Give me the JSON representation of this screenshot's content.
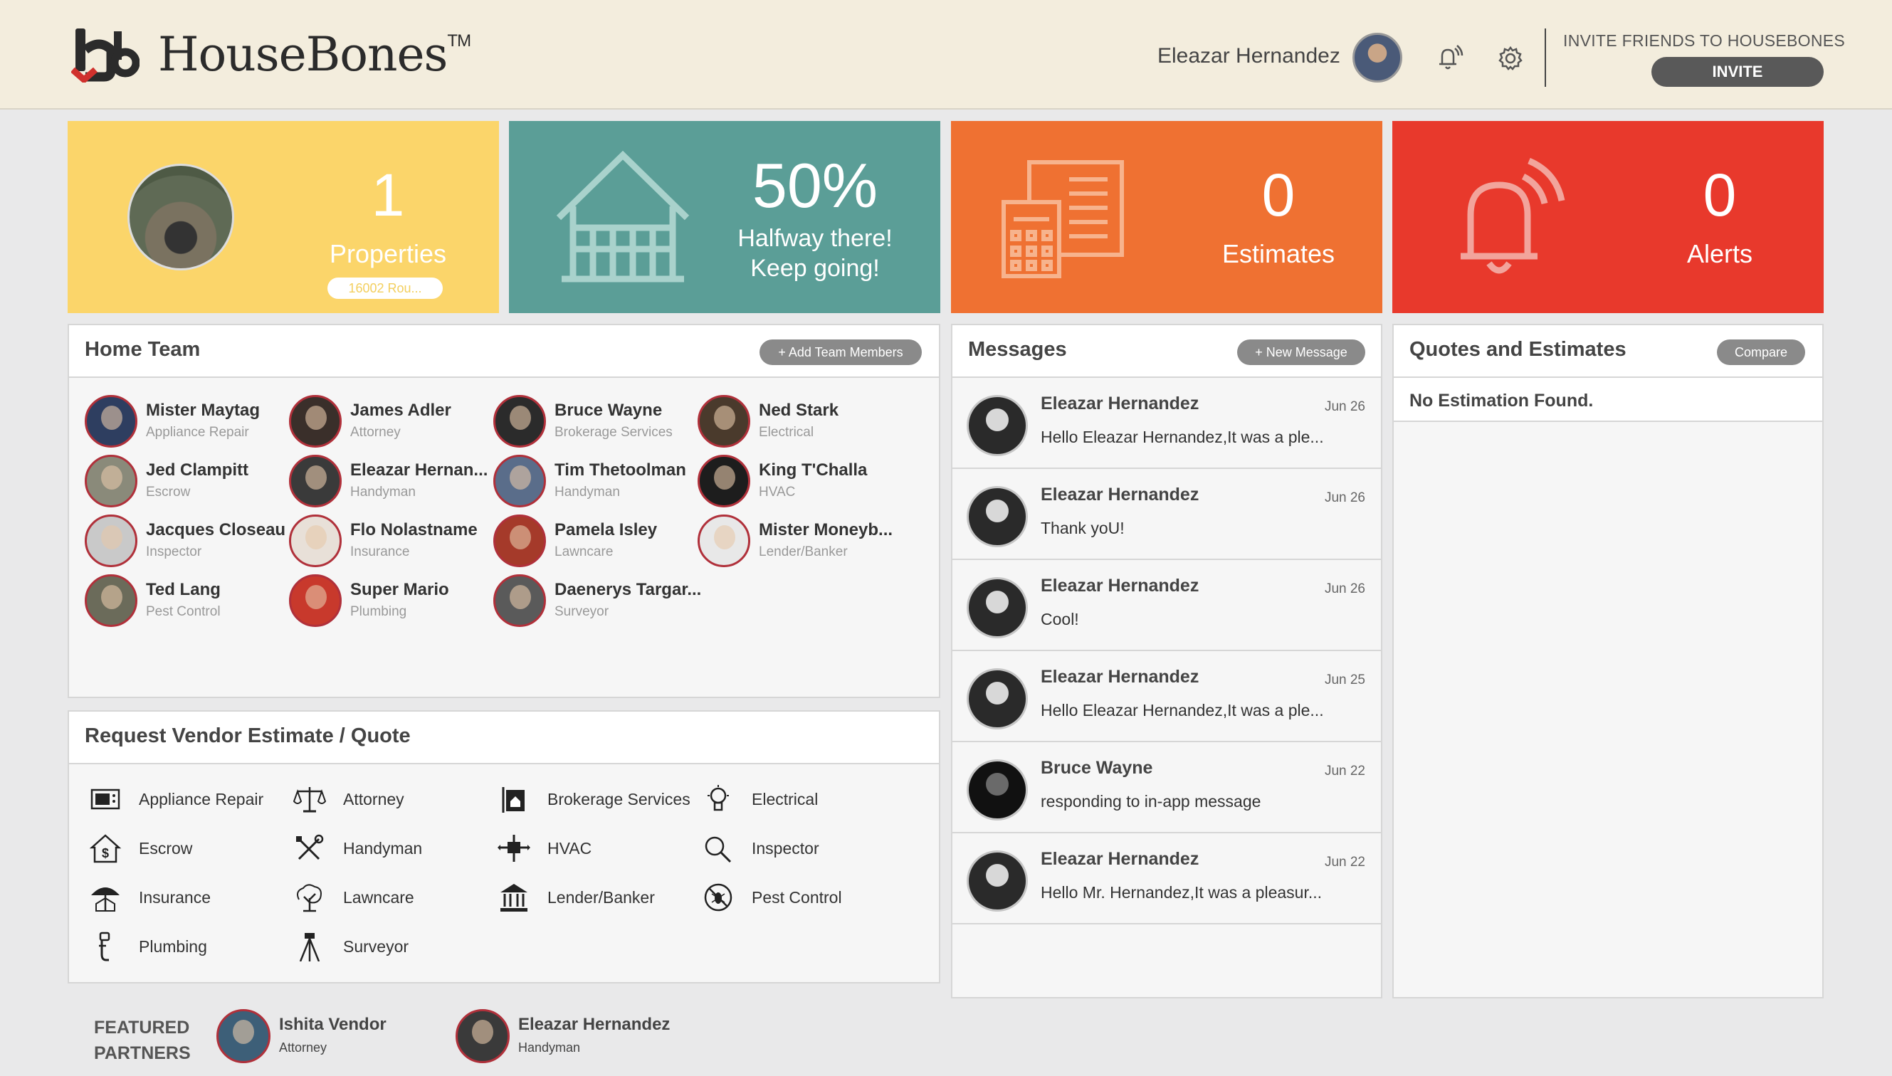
{
  "header": {
    "brand": "HouseBones",
    "trademark": "TM",
    "user_name": "Eleazar Hernandez",
    "invite_title": "INVITE FRIENDS TO HOUSEBONES",
    "invite_button": "INVITE"
  },
  "tiles": {
    "properties": {
      "count": "1",
      "label": "Properties",
      "address": "16002 Rou..."
    },
    "progress": {
      "percent": "50%",
      "line1": "Halfway there!",
      "line2": "Keep going!"
    },
    "estimates": {
      "count": "0",
      "label": "Estimates"
    },
    "alerts": {
      "count": "0",
      "label": "Alerts"
    }
  },
  "colors": {
    "properties": "#fbd56a",
    "progress": "#5b9e97",
    "estimates": "#ef7132",
    "alerts": "#e8392c",
    "avatar_ring": "#b0303a"
  },
  "home_team": {
    "title": "Home Team",
    "add_button": "+ Add Team Members",
    "members": [
      {
        "name": "Mister Maytag",
        "role": "Appliance Repair"
      },
      {
        "name": "James Adler",
        "role": "Attorney"
      },
      {
        "name": "Bruce Wayne",
        "role": "Brokerage Services"
      },
      {
        "name": "Ned Stark",
        "role": "Electrical"
      },
      {
        "name": "Jed Clampitt",
        "role": "Escrow"
      },
      {
        "name": "Eleazar Hernan...",
        "role": "Handyman"
      },
      {
        "name": "Tim Thetoolman",
        "role": "Handyman"
      },
      {
        "name": "King T'Challa",
        "role": "HVAC"
      },
      {
        "name": "Jacques Closeau",
        "role": "Inspector"
      },
      {
        "name": "Flo Nolastname",
        "role": "Insurance"
      },
      {
        "name": "Pamela Isley",
        "role": "Lawncare"
      },
      {
        "name": "Mister Moneyb...",
        "role": "Lender/Banker"
      },
      {
        "name": "Ted Lang",
        "role": "Pest Control"
      },
      {
        "name": "Super Mario",
        "role": "Plumbing"
      },
      {
        "name": "Daenerys Targar...",
        "role": "Surveyor"
      }
    ]
  },
  "vendor_estimate": {
    "title": "Request Vendor Estimate / Quote",
    "categories": [
      {
        "label": "Appliance Repair",
        "icon": "appliance-icon"
      },
      {
        "label": "Attorney",
        "icon": "scales-icon"
      },
      {
        "label": "Brokerage Services",
        "icon": "brokerage-icon"
      },
      {
        "label": "Electrical",
        "icon": "lightbulb-icon"
      },
      {
        "label": "Escrow",
        "icon": "dollar-house-icon"
      },
      {
        "label": "Handyman",
        "icon": "tools-icon"
      },
      {
        "label": "HVAC",
        "icon": "hvac-icon"
      },
      {
        "label": "Inspector",
        "icon": "magnifier-icon"
      },
      {
        "label": "Insurance",
        "icon": "umbrella-house-icon"
      },
      {
        "label": "Lawncare",
        "icon": "tree-icon"
      },
      {
        "label": "Lender/Banker",
        "icon": "bank-icon"
      },
      {
        "label": "Pest Control",
        "icon": "no-bug-icon"
      },
      {
        "label": "Plumbing",
        "icon": "pipe-icon"
      },
      {
        "label": "Surveyor",
        "icon": "tripod-icon"
      }
    ]
  },
  "messages": {
    "title": "Messages",
    "new_button": "+ New Message",
    "items": [
      {
        "from": "Eleazar Hernandez",
        "date": "Jun 26",
        "text": "Hello Eleazar Hernandez,It was a ple..."
      },
      {
        "from": "Eleazar Hernandez",
        "date": "Jun 26",
        "text": "Thank yoU!"
      },
      {
        "from": "Eleazar Hernandez",
        "date": "Jun 26",
        "text": "Cool!"
      },
      {
        "from": "Eleazar Hernandez",
        "date": "Jun 25",
        "text": "Hello Eleazar Hernandez,It was a ple..."
      },
      {
        "from": "Bruce Wayne",
        "date": "Jun 22",
        "text": "responding to in-app message"
      },
      {
        "from": "Eleazar Hernandez",
        "date": "Jun 22",
        "text": "Hello Mr. Hernandez,It was a pleasur..."
      }
    ]
  },
  "quotes": {
    "title": "Quotes and Estimates",
    "compare_button": "Compare",
    "empty_text": "No Estimation Found."
  },
  "featured": {
    "label_line1": "FEATURED",
    "label_line2": "PARTNERS",
    "partners": [
      {
        "name": "Ishita Vendor",
        "role": "Attorney"
      },
      {
        "name": "Eleazar Hernandez",
        "role": "Handyman"
      }
    ]
  }
}
